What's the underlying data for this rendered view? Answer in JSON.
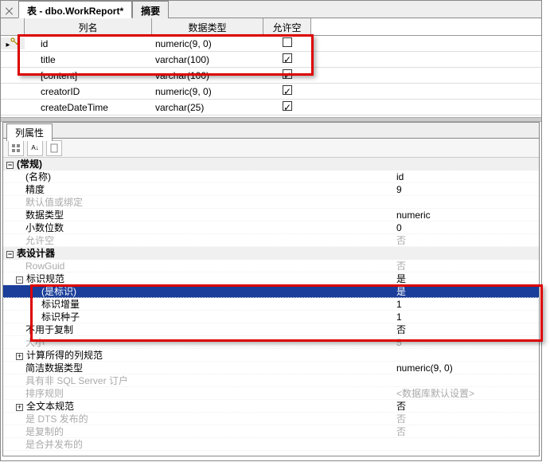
{
  "tabs": {
    "main": "表 - dbo.WorkReport*",
    "summary": "摘要"
  },
  "grid": {
    "headers": {
      "name": "列名",
      "type": "数据类型",
      "null": "允许空"
    },
    "rows": [
      {
        "key": true,
        "name": "id",
        "type": "numeric(9, 0)",
        "null": false
      },
      {
        "key": false,
        "name": "title",
        "type": "varchar(100)",
        "null": true
      },
      {
        "key": false,
        "name": "[content]",
        "type": "varchar(100)",
        "null": true
      },
      {
        "key": false,
        "name": "creatorID",
        "type": "numeric(9, 0)",
        "null": true
      },
      {
        "key": false,
        "name": "createDateTime",
        "type": "varchar(25)",
        "null": true
      }
    ]
  },
  "props_title": "列属性",
  "toolbar": {
    "cat": "分类",
    "az": "A↓Z",
    "page": "页"
  },
  "props": {
    "cat_general": "(常规)",
    "name_k": "(名称)",
    "name_v": "id",
    "precision_k": "精度",
    "precision_v": "9",
    "default_k": "默认值或绑定",
    "default_v": "",
    "datatype_k": "数据类型",
    "datatype_v": "numeric",
    "scale_k": "小数位数",
    "scale_v": "0",
    "allownull_k": "允许空",
    "allownull_v": "否",
    "cat_designer": "表设计器",
    "rowguid_k": "RowGuid",
    "rowguid_v": "否",
    "identity_k": "标识规范",
    "identity_v": "是",
    "isidentity_k": "(是标识)",
    "isidentity_v": "是",
    "increment_k": "标识增量",
    "increment_v": "1",
    "seed_k": "标识种子",
    "seed_v": "1",
    "notforrepl_k": "不用于复制",
    "notforrepl_v": "否",
    "size_k": "大小",
    "size_v": "5",
    "computed_k": "计算所得的列规范",
    "concise_k": "简洁数据类型",
    "concise_v": "numeric(9, 0)",
    "nonsql_k": "具有非 SQL Server 订户",
    "nonsql_v": "",
    "collation_k": "排序规则",
    "collation_v": "<数据库默认设置>",
    "fulltext_k": "全文本规范",
    "fulltext_v": "否",
    "dts_k": "是 DTS 发布的",
    "dts_v": "否",
    "replicated_k": "是复制的",
    "replicated_v": "否",
    "merge_k": "是合并发布的"
  }
}
